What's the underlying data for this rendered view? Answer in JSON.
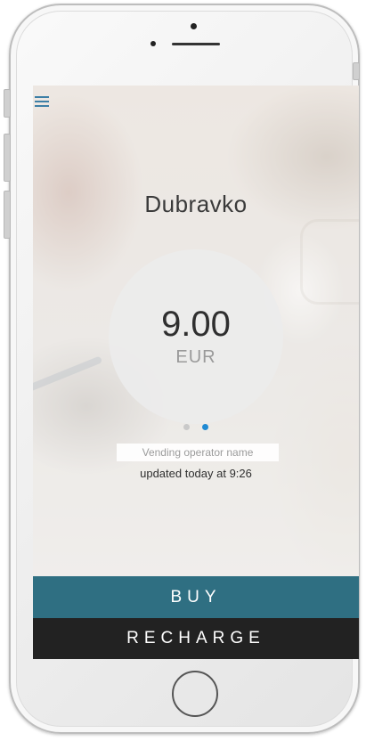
{
  "profile": {
    "name": "Dubravko"
  },
  "balance": {
    "amount": "9.00",
    "currency": "EUR"
  },
  "pager": {
    "count": 2,
    "active_index": 1
  },
  "operator": {
    "placeholder": "Vending operator name",
    "updated": "updated today at 9:26"
  },
  "actions": {
    "buy_label": "BUY",
    "recharge_label": "RECHARGE"
  },
  "icons": {
    "menu": "hamburger-menu-icon"
  },
  "colors": {
    "accent_blue": "#1f8ad3",
    "buy_background": "#2f6f82",
    "recharge_background": "#222222"
  }
}
